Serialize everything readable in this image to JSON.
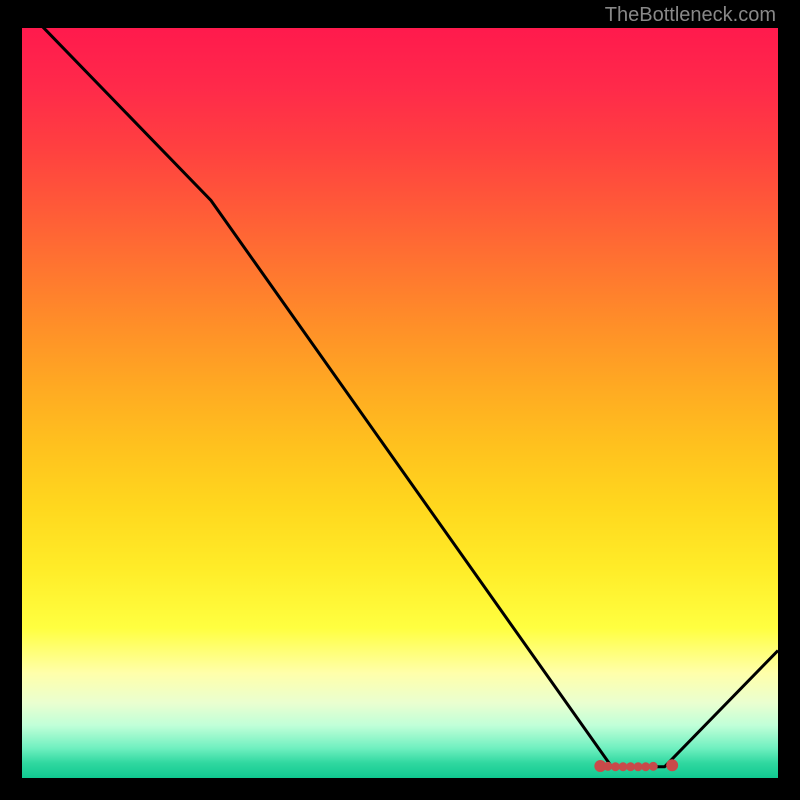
{
  "attribution": "TheBottleneck.com",
  "chart_data": {
    "type": "line",
    "title": "",
    "xlabel": "",
    "ylabel": "",
    "xlim": [
      0,
      100
    ],
    "ylim": [
      0,
      100
    ],
    "series": [
      {
        "name": "curve",
        "x": [
          0,
          25,
          78,
          85,
          100
        ],
        "y": [
          103,
          77,
          1.5,
          1.5,
          17
        ]
      }
    ],
    "markers": {
      "name": "optimal-range",
      "color": "#c94a4a",
      "points_x": [
        76.5,
        77.5,
        78.5,
        79.5,
        80.5,
        81.5,
        82.5,
        83.5,
        86.0
      ],
      "points_y": [
        1.6,
        1.55,
        1.5,
        1.5,
        1.5,
        1.5,
        1.5,
        1.55,
        1.7
      ]
    }
  }
}
